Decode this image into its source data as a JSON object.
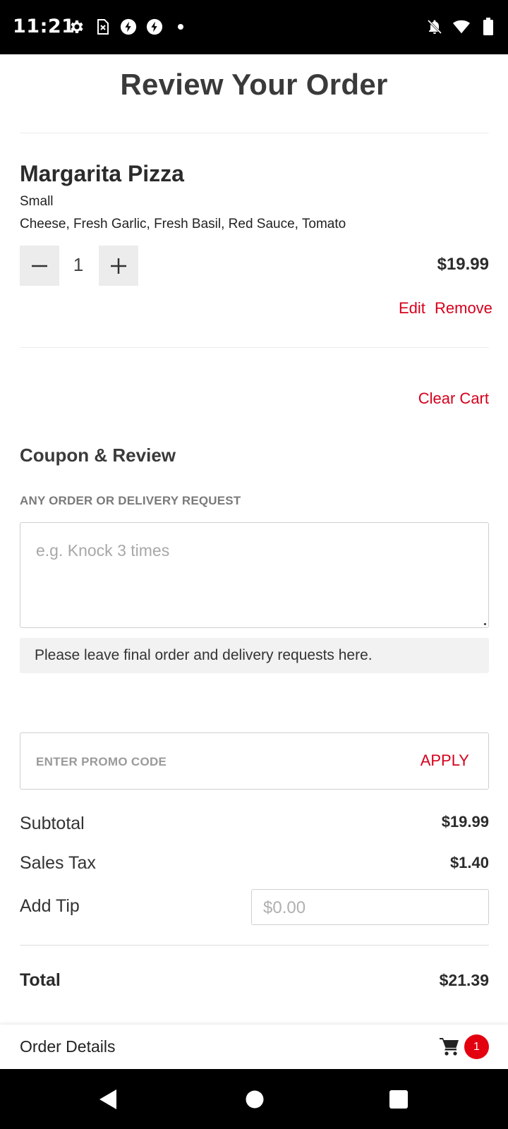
{
  "status_bar": {
    "time": "11:21",
    "left_icons": [
      "gear-icon",
      "sim-icon",
      "bolt-circle-icon",
      "bolt-circle-icon",
      "dot-icon"
    ],
    "right_icons": [
      "bell-off-icon",
      "wifi-icon",
      "battery-icon"
    ]
  },
  "page": {
    "title": "Review Your Order"
  },
  "item": {
    "name": "Margarita Pizza",
    "size": "Small",
    "toppings": "Cheese, Fresh Garlic, Fresh Basil, Red Sauce, Tomato",
    "quantity": "1",
    "price": "$19.99",
    "edit_label": "Edit",
    "remove_label": "Remove"
  },
  "cart": {
    "clear_label": "Clear Cart"
  },
  "coupon_review": {
    "title": "Coupon & Review",
    "request_label": "ANY ORDER OR DELIVERY REQUEST",
    "request_placeholder": "e.g. Knock 3 times",
    "request_note": "Please leave final order and delivery requests here.",
    "promo_placeholder": "ENTER PROMO CODE",
    "apply_label": "APPLY"
  },
  "totals": {
    "subtotal_label": "Subtotal",
    "subtotal_value": "$19.99",
    "tax_label": "Sales Tax",
    "tax_value": "$1.40",
    "tip_label": "Add Tip",
    "tip_placeholder": "$0.00",
    "total_label": "Total",
    "total_value": "$21.39"
  },
  "order_bar": {
    "label": "Order Details",
    "cart_count": "1"
  },
  "colors": {
    "accent": "#d6001c",
    "badge": "#e3000f",
    "title": "#3a3a3a"
  }
}
